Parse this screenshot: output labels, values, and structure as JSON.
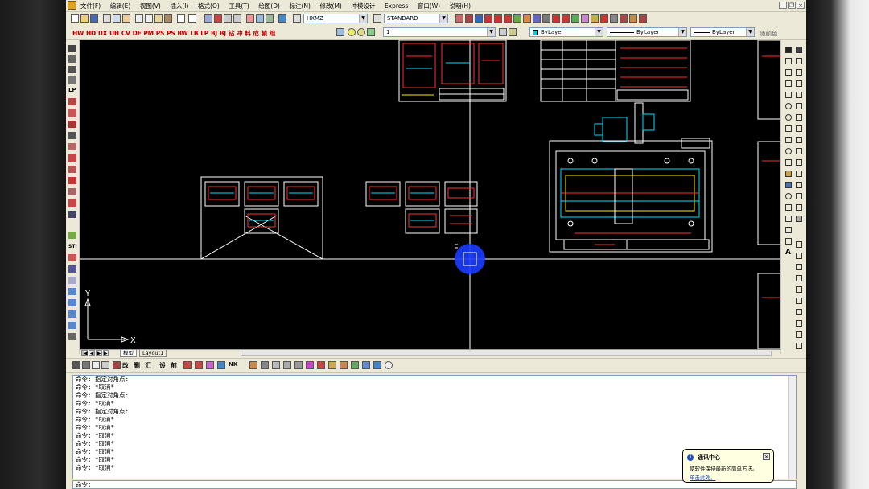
{
  "menubar": {
    "items": [
      "文件(F)",
      "编辑(E)",
      "视图(V)",
      "插入(I)",
      "格式(O)",
      "工具(T)",
      "绘图(D)",
      "标注(N)",
      "修改(M)",
      "冲模设计",
      "Express",
      "窗口(W)",
      "说明(H)"
    ]
  },
  "toolbar1": {
    "text_style": "HXMZ",
    "dim_style": "STANDARD"
  },
  "toolbar2": {
    "red_tools": [
      "HW",
      "HD",
      "UX",
      "UH",
      "CV",
      "DF",
      "PM",
      "PS",
      "PS",
      "BW",
      "LB",
      "LP",
      "BJ",
      "BJ",
      "钻",
      "冲",
      "料",
      "成",
      "帧",
      "组"
    ],
    "layer": "1",
    "color": "ByLayer",
    "linetype": "ByLayer",
    "lineweight": "ByLayer",
    "plotstyle": "随颜色"
  },
  "left_toolbar": {
    "labels": [
      "LP",
      "STI"
    ]
  },
  "ucs": {
    "y": "Y",
    "x": "X"
  },
  "tabs": {
    "model": "模型",
    "layout1": "Layout1"
  },
  "bottom_toolbar": {
    "labels": [
      "改",
      "删",
      "汇",
      "设",
      "前"
    ],
    "ndk": "NK"
  },
  "command_history": [
    "命令: 指定对角点:",
    "命令: *取消*",
    "命令: 指定对角点:",
    "命令: *取消*",
    "命令: 指定对角点:",
    "命令: *取消*",
    "命令: *取消*",
    "命令: *取消*",
    "命令: *取消*",
    "命令: *取消*",
    "命令: *取消*",
    "命令: *取消*"
  ],
  "command_prompt": "命令:",
  "balloon": {
    "title": "通讯中心",
    "message": "使软件保持最新的简单方法。",
    "link": "单击此处。"
  },
  "colors": {
    "canvas": "#000000",
    "chrome": "#ece9d8",
    "cursor": "#1a3cff",
    "drawing_red": "#ff3030",
    "drawing_cyan": "#00e0ff"
  }
}
